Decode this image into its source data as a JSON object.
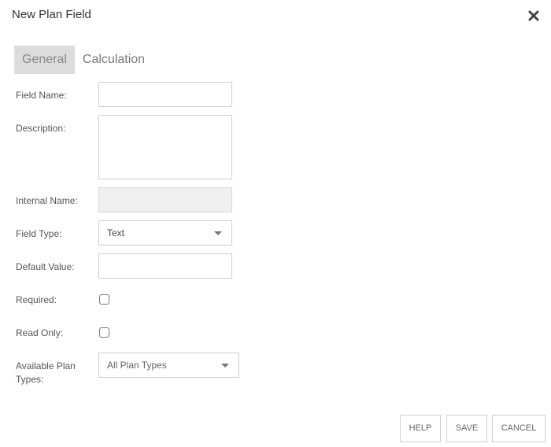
{
  "dialog": {
    "title": "New Plan Field",
    "close_icon": "close-icon"
  },
  "tabs": [
    {
      "label": "General",
      "active": true
    },
    {
      "label": "Calculation",
      "active": false
    }
  ],
  "form": {
    "field_name": {
      "label": "Field Name:",
      "value": ""
    },
    "description": {
      "label": "Description:",
      "value": ""
    },
    "internal_name": {
      "label": "Internal Name:",
      "value": "",
      "disabled": true
    },
    "field_type": {
      "label": "Field Type:",
      "value": "Text"
    },
    "default_value": {
      "label": "Default Value:",
      "value": ""
    },
    "required": {
      "label": "Required:",
      "checked": false
    },
    "read_only": {
      "label": "Read Only:",
      "checked": false
    },
    "available_plan_types": {
      "label": "Available Plan Types:",
      "value": "All Plan Types"
    }
  },
  "buttons": {
    "help": "HELP",
    "save": "SAVE",
    "cancel": "CANCEL"
  }
}
